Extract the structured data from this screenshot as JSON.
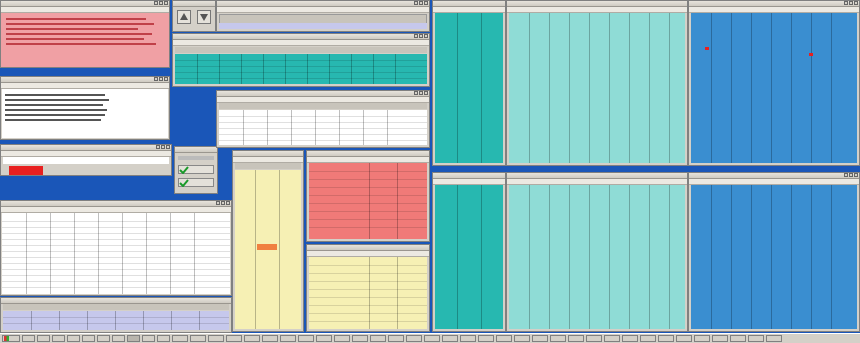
{
  "colors": {
    "desktop": "#1a56b8",
    "alert_pink": "#f0a0a4",
    "teal": "#27b8b0",
    "salmon": "#f07a78",
    "pale_yellow": "#f6f0b4",
    "lavender": "#c6c8ec",
    "light_teal": "#8fdcd6",
    "mid_blue": "#3a8ed0",
    "red_block": "#e82020"
  },
  "icons": [
    "up-arrow-icon",
    "down-arrow-icon",
    "green-check-icon",
    "minimize-icon",
    "maximize-icon",
    "close-icon"
  ],
  "taskbar": {
    "start_icon": "windows-logo-icon",
    "button_count": 44
  }
}
